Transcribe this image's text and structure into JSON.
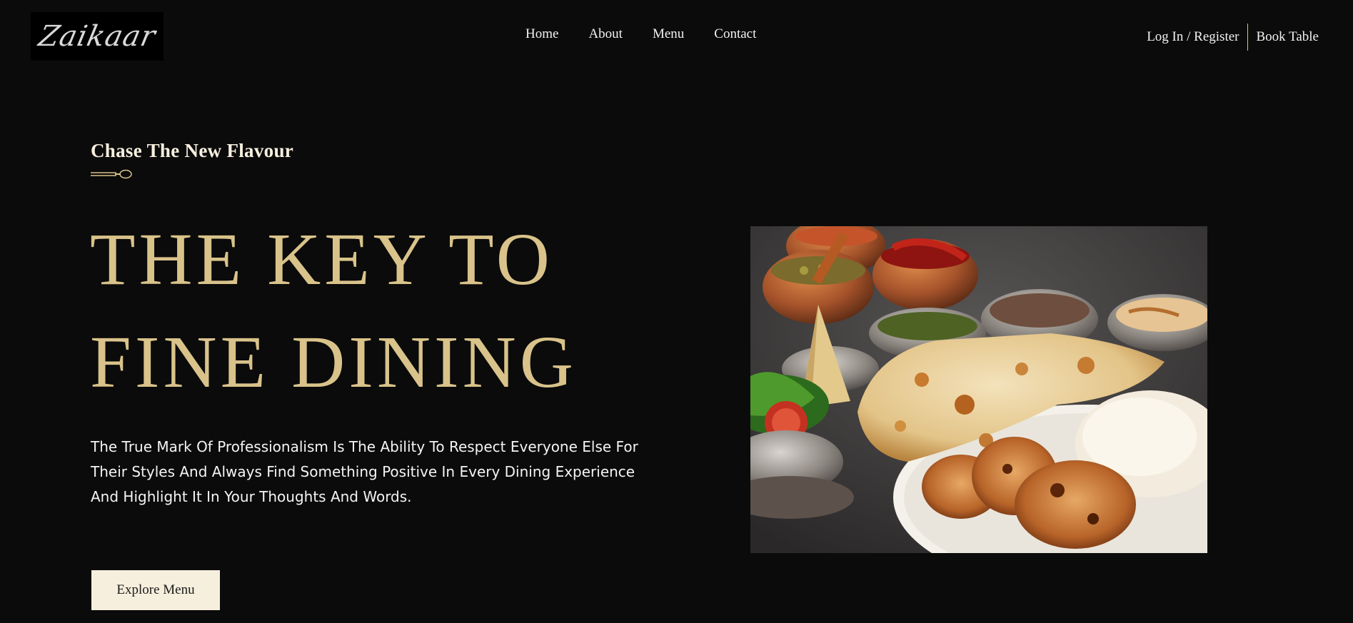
{
  "brand": {
    "logo_text": "Zaikaar"
  },
  "nav": {
    "items": [
      "Home",
      "About",
      "Menu",
      "Contact"
    ]
  },
  "header_actions": {
    "login": "Log In / Register",
    "book": "Book Table"
  },
  "hero": {
    "kicker": "Chase The New Flavour",
    "headline_line1": "THE KEY TO",
    "headline_line2": "FINE DINING",
    "description": "The True Mark Of Professionalism Is The Ability To Respect Everyone Else For Their Styles And Always Find Something Positive In Every Dining Experience And Highlight It In Your Thoughts And Words.",
    "cta_label": "Explore Menu"
  },
  "colors": {
    "background": "#0b0b0b",
    "accent_gold": "#d9c38a",
    "button_bg": "#f7efdd"
  },
  "icons": [
    "spoon-divider-icon"
  ]
}
